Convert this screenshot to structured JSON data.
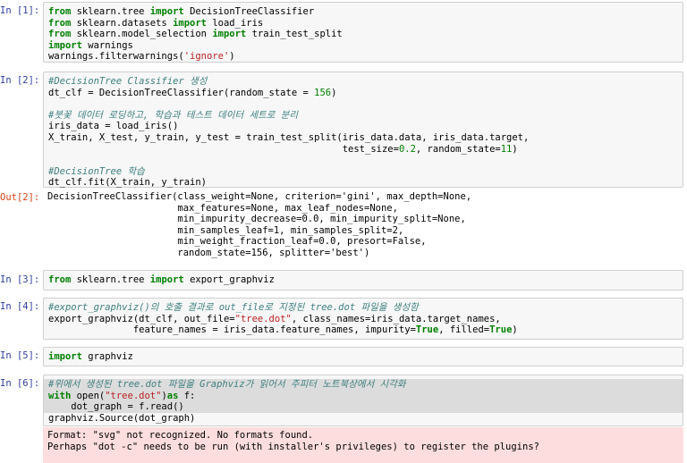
{
  "cells": [
    {
      "prompt": "In [1]:",
      "lines": [
        [
          [
            "kw",
            "from"
          ],
          [
            "",
            "sklearn.tree "
          ],
          [
            "kw",
            "import"
          ],
          [
            "",
            "DecisionTreeClassifier"
          ]
        ],
        [
          [
            "kw",
            "from"
          ],
          [
            "",
            "sklearn.datasets "
          ],
          [
            "kw",
            "import"
          ],
          [
            "",
            "load_iris"
          ]
        ],
        [
          [
            "kw",
            "from"
          ],
          [
            "",
            "sklearn.model_selection "
          ],
          [
            "kw",
            "import"
          ],
          [
            "",
            "train_test_split"
          ]
        ],
        [
          [
            "kw",
            "import"
          ],
          [
            "",
            "warnings"
          ]
        ],
        [
          [
            "",
            "warnings.filterwarnings("
          ],
          [
            "st",
            "'ignore'"
          ],
          [
            "",
            ")"
          ]
        ]
      ]
    },
    {
      "prompt": "In [2]:",
      "lines": [
        [
          [
            "cm",
            "#DecisionTree Classifier 생성"
          ]
        ],
        [
          [
            "",
            "dt_clf = DecisionTreeClassifier(random_state = "
          ],
          [
            "nm",
            "156"
          ],
          [
            "",
            ")"
          ]
        ],
        [
          [
            "",
            ""
          ]
        ],
        [
          [
            "cm",
            "#붓꽃 데이터 로딩하고, 학습과 테스트 데이터 세트로 분리"
          ]
        ],
        [
          [
            "",
            "iris_data = load_iris()"
          ]
        ],
        [
          [
            "",
            "X_train, X_test, y_train, y_test = train_test_split(iris_data.data, iris_data.target,"
          ]
        ],
        [
          [
            "",
            "                                                    test_size="
          ],
          [
            "nm",
            "0.2"
          ],
          [
            "",
            ", random_state="
          ],
          [
            "nm",
            "11"
          ],
          [
            "",
            ")"
          ]
        ],
        [
          [
            "",
            ""
          ]
        ],
        [
          [
            "cm",
            "#DecisionTree 학습"
          ]
        ],
        [
          [
            "",
            "dt_clf.fit(X_train, y_train)"
          ]
        ]
      ],
      "out_prompt": "Out[2]:",
      "output_lines": [
        "DecisionTreeClassifier(class_weight=None, criterion='gini', max_depth=None,",
        "                       max_features=None, max_leaf_nodes=None,",
        "                       min_impurity_decrease=0.0, min_impurity_split=None,",
        "                       min_samples_leaf=1, min_samples_split=2,",
        "                       min_weight_fraction_leaf=0.0, presort=False,",
        "                       random_state=156, splitter='best')"
      ]
    },
    {
      "prompt": "In [3]:",
      "lines": [
        [
          [
            "kw",
            "from"
          ],
          [
            "",
            "sklearn.tree "
          ],
          [
            "kw",
            "import"
          ],
          [
            "",
            "export_graphviz"
          ]
        ]
      ]
    },
    {
      "prompt": "In [4]:",
      "lines": [
        [
          [
            "cm",
            "#export_graphviz()의 호출 결과로 out_file로 지정된 tree.dot 파일을 생성함"
          ]
        ],
        [
          [
            "",
            "export_graphviz(dt_clf, out_file="
          ],
          [
            "st",
            "\"tree.dot\""
          ],
          [
            "",
            ", class_names=iris_data.target_names,"
          ]
        ],
        [
          [
            "",
            "               feature_names = iris_data.feature_names, impurity="
          ],
          [
            "kc",
            "True"
          ],
          [
            "",
            ", filled="
          ],
          [
            "kc",
            "True"
          ],
          [
            "",
            ")"
          ]
        ]
      ]
    },
    {
      "prompt": "In [5]:",
      "lines": [
        [
          [
            "kw",
            "import"
          ],
          [
            "",
            "graphviz"
          ]
        ]
      ]
    },
    {
      "prompt": "In [6]:",
      "lines": [
        [
          [
            "cm",
            "#위에서 생성된 tree.dot 파일을 Graphviz가 읽어서 주피터 노트북상에서 시각화"
          ]
        ],
        [
          [
            "kw",
            "with"
          ],
          [
            "",
            "open("
          ],
          [
            "st",
            "\"tree.dot\""
          ],
          [
            "",
            ")"
          ],
          [
            "kw",
            "as"
          ],
          [
            "",
            "f:"
          ]
        ],
        [
          [
            "",
            "    dot_graph = f.read()"
          ]
        ],
        [
          [
            "",
            "graphviz.Source(dot_graph)"
          ]
        ]
      ],
      "error_lines": [
        "Format: \"svg\" not recognized. No formats found.",
        "Perhaps \"dot -c\" needs to be run (with installer's privileges) to register the plugins?"
      ]
    }
  ]
}
